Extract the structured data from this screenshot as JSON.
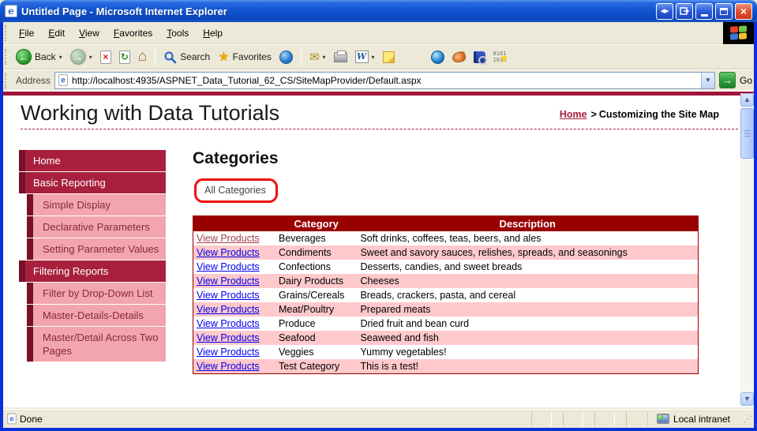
{
  "window": {
    "title": "Untitled Page - Microsoft Internet Explorer"
  },
  "menu": {
    "items": [
      "File",
      "Edit",
      "View",
      "Favorites",
      "Tools",
      "Help"
    ]
  },
  "toolbar": {
    "back_label": "Back",
    "search_label": "Search",
    "favorites_label": "Favorites",
    "go_label": "Go"
  },
  "address": {
    "label": "Address",
    "url": "http://localhost:4935/ASPNET_Data_Tutorial_62_CS/SiteMapProvider/Default.aspx"
  },
  "page": {
    "title": "Working with Data Tutorials",
    "breadcrumb": {
      "home": "Home",
      "separator": ">",
      "current": "Customizing the Site Map"
    }
  },
  "sidebar": {
    "items": [
      {
        "label": "Home",
        "level": 1
      },
      {
        "label": "Basic Reporting",
        "level": 1
      },
      {
        "label": "Simple Display",
        "level": 2
      },
      {
        "label": "Declarative Parameters",
        "level": 2
      },
      {
        "label": "Setting Parameter Values",
        "level": 2
      },
      {
        "label": "Filtering Reports",
        "level": 1
      },
      {
        "label": "Filter by Drop-Down List",
        "level": 2
      },
      {
        "label": "Master-Details-Details",
        "level": 2
      },
      {
        "label": "Master/Detail Across Two Pages",
        "level": 2
      }
    ]
  },
  "main": {
    "heading": "Categories",
    "all_categories_label": "All Categories"
  },
  "table": {
    "headers": [
      "",
      "Category",
      "Description"
    ],
    "rows": [
      {
        "link": "View Products",
        "category": "Beverages",
        "description": "Soft drinks, coffees, teas, beers, and ales"
      },
      {
        "link": "View Products",
        "category": "Condiments",
        "description": "Sweet and savory sauces, relishes, spreads, and seasonings"
      },
      {
        "link": "View Products",
        "category": "Confections",
        "description": "Desserts, candies, and sweet breads"
      },
      {
        "link": "View Products",
        "category": "Dairy Products",
        "description": "Cheeses"
      },
      {
        "link": "View Products",
        "category": "Grains/Cereals",
        "description": "Breads, crackers, pasta, and cereal"
      },
      {
        "link": "View Products",
        "category": "Meat/Poultry",
        "description": "Prepared meats"
      },
      {
        "link": "View Products",
        "category": "Produce",
        "description": "Dried fruit and bean curd"
      },
      {
        "link": "View Products",
        "category": "Seafood",
        "description": "Seaweed and fish"
      },
      {
        "link": "View Products",
        "category": "Veggies",
        "description": "Yummy vegetables!"
      },
      {
        "link": "View Products",
        "category": "Test Category",
        "description": "This is a test!"
      }
    ]
  },
  "status": {
    "message": "Done",
    "zone": "Local intranet"
  },
  "colors": {
    "site_crimson": "#A8203E",
    "site_dark_maroon": "#7A1023",
    "table_header_red": "#990000",
    "row_pink": "#FFC9CC",
    "link_blue": "#0000EE",
    "link_visited": "#A2404F",
    "annotation_red": "#EE1111",
    "window_border_blue": "#0831D9"
  }
}
